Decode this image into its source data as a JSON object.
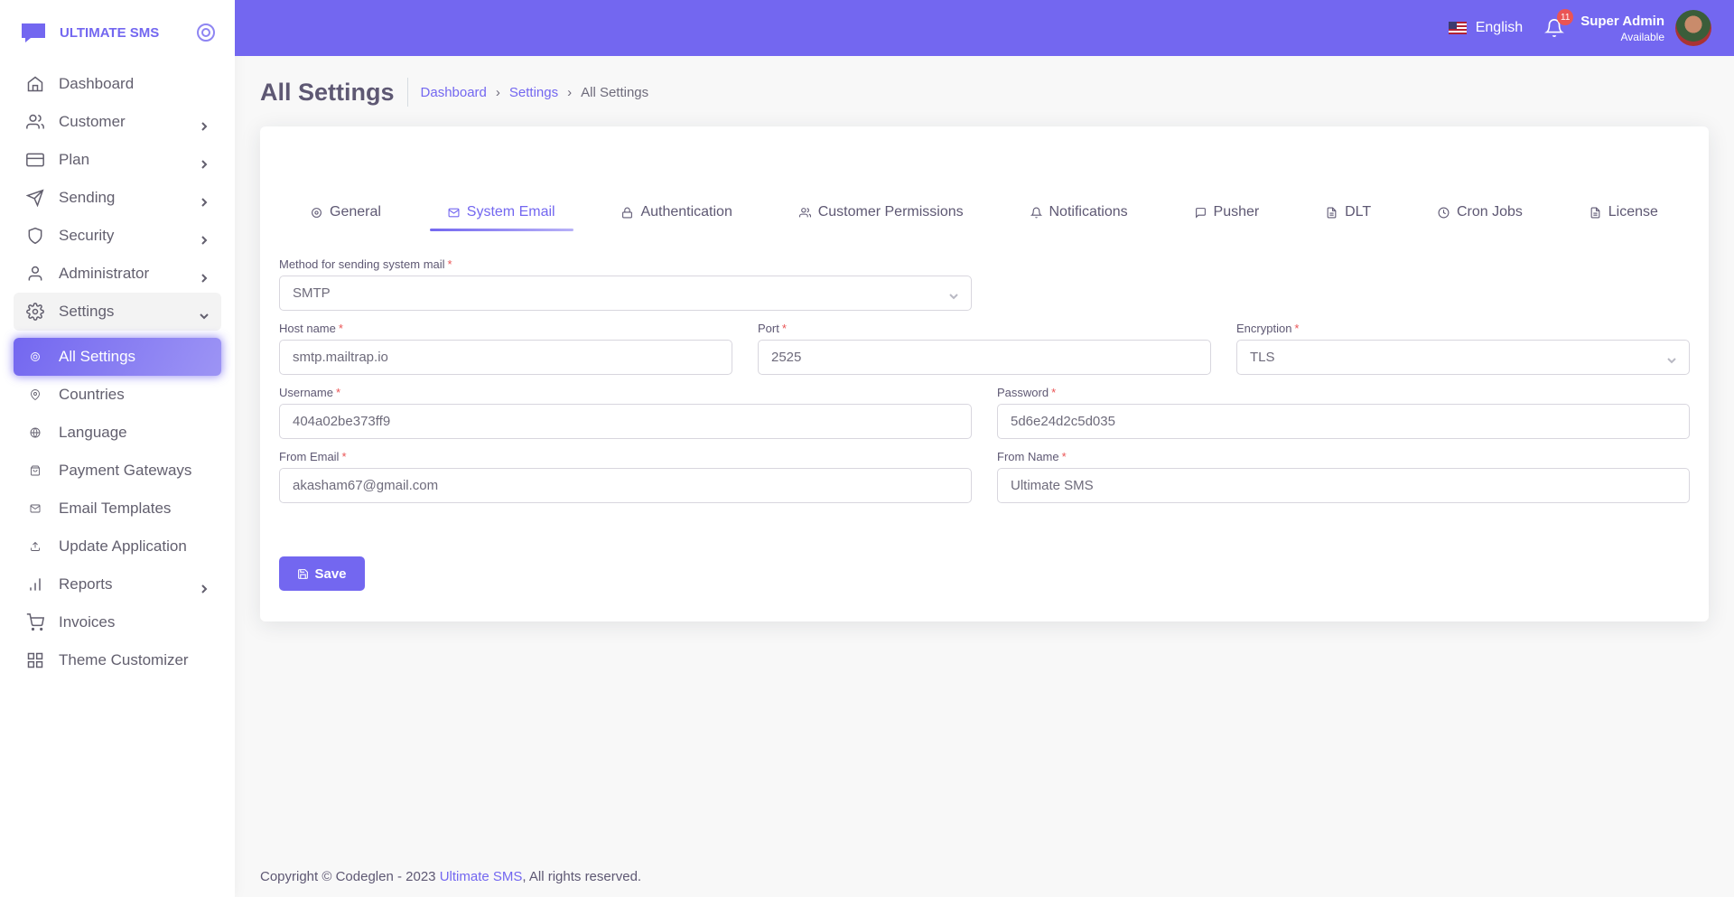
{
  "brand": {
    "name": "ULTIMATE SMS"
  },
  "sidebar": {
    "items": [
      {
        "label": "Dashboard",
        "icon": "home-icon"
      },
      {
        "label": "Customer",
        "icon": "users-icon"
      },
      {
        "label": "Plan",
        "icon": "credit-card-icon"
      },
      {
        "label": "Sending",
        "icon": "send-icon"
      },
      {
        "label": "Security",
        "icon": "shield-icon"
      },
      {
        "label": "Administrator",
        "icon": "user-icon"
      },
      {
        "label": "Settings",
        "icon": "gear-icon"
      },
      {
        "label": "All Settings",
        "icon": "gear-icon"
      },
      {
        "label": "Countries",
        "icon": "map-pin-icon"
      },
      {
        "label": "Language",
        "icon": "globe-icon"
      },
      {
        "label": "Payment Gateways",
        "icon": "shopping-bag-icon"
      },
      {
        "label": "Email Templates",
        "icon": "mail-icon"
      },
      {
        "label": "Update Application",
        "icon": "upload-icon"
      },
      {
        "label": "Reports",
        "icon": "bar-chart-icon"
      },
      {
        "label": "Invoices",
        "icon": "shopping-cart-icon"
      },
      {
        "label": "Theme Customizer",
        "icon": "grid-icon"
      }
    ]
  },
  "header": {
    "language": "English",
    "notification_count": "11",
    "user_name": "Super Admin",
    "user_status": "Available"
  },
  "page": {
    "title": "All Settings",
    "breadcrumb": [
      "Dashboard",
      "Settings",
      "All Settings"
    ]
  },
  "tabs": [
    {
      "label": "General",
      "icon": "gear-icon"
    },
    {
      "label": "System Email",
      "icon": "mail-icon"
    },
    {
      "label": "Authentication",
      "icon": "lock-icon"
    },
    {
      "label": "Customer Permissions",
      "icon": "users-icon"
    },
    {
      "label": "Notifications",
      "icon": "bell-icon"
    },
    {
      "label": "Pusher",
      "icon": "message-square-icon"
    },
    {
      "label": "DLT",
      "icon": "file-text-icon"
    },
    {
      "label": "Cron Jobs",
      "icon": "clock-icon"
    },
    {
      "label": "License",
      "icon": "file-text-icon"
    }
  ],
  "form": {
    "method": {
      "label": "Method for sending system mail",
      "value": "SMTP"
    },
    "host": {
      "label": "Host name",
      "value": "smtp.mailtrap.io"
    },
    "port": {
      "label": "Port",
      "value": "2525"
    },
    "encryption": {
      "label": "Encryption",
      "value": "TLS"
    },
    "username": {
      "label": "Username",
      "value": "404a02be373ff9"
    },
    "password": {
      "label": "Password",
      "value": "5d6e24d2c5d035"
    },
    "from_email": {
      "label": "From Email",
      "value": "akasham67@gmail.com"
    },
    "from_name": {
      "label": "From Name",
      "value": "Ultimate SMS"
    },
    "required_mark": "*",
    "save_label": "Save"
  },
  "footer": {
    "prefix": "Copyright © Codeglen - 2023",
    "link": "Ultimate SMS",
    "suffix": ", All rights reserved."
  },
  "colors": {
    "primary": "#7367f0",
    "danger": "#ea5455"
  }
}
